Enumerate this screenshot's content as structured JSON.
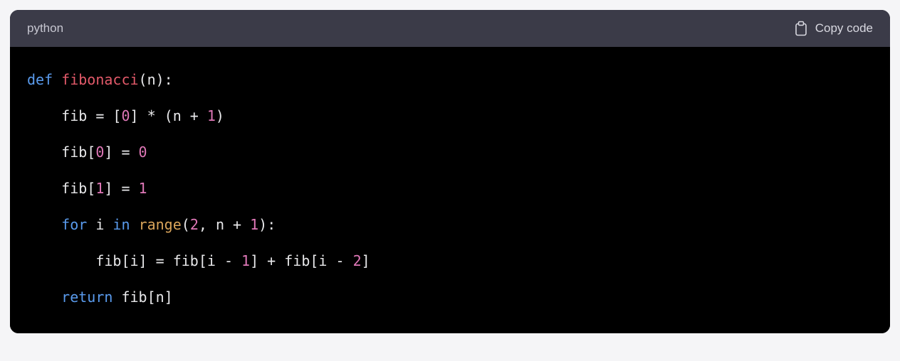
{
  "header": {
    "language": "python",
    "copy_label": "Copy code"
  },
  "code": {
    "tokens": [
      [
        {
          "cls": "tok-kw",
          "t": "def"
        },
        {
          "cls": "tok-default",
          "t": " "
        },
        {
          "cls": "tok-fn",
          "t": "fibonacci"
        },
        {
          "cls": "tok-default",
          "t": "(n):"
        }
      ],
      [
        {
          "cls": "tok-default",
          "t": "    fib = ["
        },
        {
          "cls": "tok-num",
          "t": "0"
        },
        {
          "cls": "tok-default",
          "t": "] * (n + "
        },
        {
          "cls": "tok-num",
          "t": "1"
        },
        {
          "cls": "tok-default",
          "t": ")"
        }
      ],
      [
        {
          "cls": "tok-default",
          "t": "    fib["
        },
        {
          "cls": "tok-num",
          "t": "0"
        },
        {
          "cls": "tok-default",
          "t": "] = "
        },
        {
          "cls": "tok-num",
          "t": "0"
        }
      ],
      [
        {
          "cls": "tok-default",
          "t": "    fib["
        },
        {
          "cls": "tok-num",
          "t": "1"
        },
        {
          "cls": "tok-default",
          "t": "] = "
        },
        {
          "cls": "tok-num",
          "t": "1"
        }
      ],
      [
        {
          "cls": "tok-default",
          "t": "    "
        },
        {
          "cls": "tok-kw",
          "t": "for"
        },
        {
          "cls": "tok-default",
          "t": " i "
        },
        {
          "cls": "tok-kw",
          "t": "in"
        },
        {
          "cls": "tok-default",
          "t": " "
        },
        {
          "cls": "tok-builtin",
          "t": "range"
        },
        {
          "cls": "tok-default",
          "t": "("
        },
        {
          "cls": "tok-num",
          "t": "2"
        },
        {
          "cls": "tok-default",
          "t": ", n + "
        },
        {
          "cls": "tok-num",
          "t": "1"
        },
        {
          "cls": "tok-default",
          "t": "):"
        }
      ],
      [
        {
          "cls": "tok-default",
          "t": "        fib[i] = fib[i - "
        },
        {
          "cls": "tok-num",
          "t": "1"
        },
        {
          "cls": "tok-default",
          "t": "] + fib[i - "
        },
        {
          "cls": "tok-num",
          "t": "2"
        },
        {
          "cls": "tok-default",
          "t": "]"
        }
      ],
      [
        {
          "cls": "tok-default",
          "t": "    "
        },
        {
          "cls": "tok-kw",
          "t": "return"
        },
        {
          "cls": "tok-default",
          "t": " fib[n]"
        }
      ]
    ]
  }
}
